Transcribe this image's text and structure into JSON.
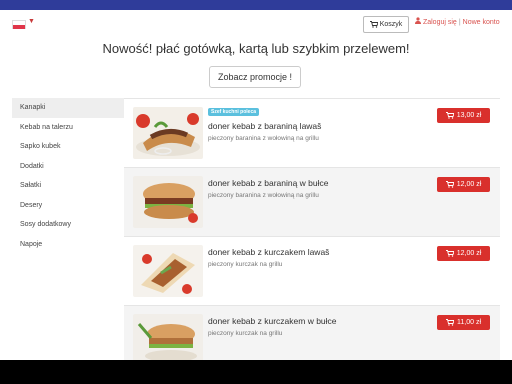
{
  "header": {
    "cart_label": "Koszyk",
    "login_label": "Zaloguj się",
    "separator": "|",
    "register_label": "Nowe konto",
    "icons": {
      "cart": "cart-icon",
      "user": "user-icon",
      "flag": "poland-flag-icon"
    }
  },
  "banner": {
    "headline": "Nowość! płać gotówką, kartą lub szybkim przelewem!",
    "promo_button": "Zobacz promocje !"
  },
  "sidebar": {
    "items": [
      {
        "label": "Kanapki",
        "active": true
      },
      {
        "label": "Kebab na talerzu",
        "active": false
      },
      {
        "label": "Sapko kubek",
        "active": false
      },
      {
        "label": "Dodatki",
        "active": false
      },
      {
        "label": "Sałatki",
        "active": false
      },
      {
        "label": "Desery",
        "active": false
      },
      {
        "label": "Sosy dodatkowy",
        "active": false
      },
      {
        "label": "Napoje",
        "active": false
      }
    ]
  },
  "products": [
    {
      "name": "doner kebab z baraniną lawaš",
      "description": "pieczony baranina z wołowiną na grillu",
      "price": "13,00 zł",
      "badge": "Szef kuchni poleca"
    },
    {
      "name": "doner kebab z baraniną w bułce",
      "description": "pieczony baranina z wołowiną na grillu",
      "price": "12,00 zł"
    },
    {
      "name": "doner kebab z kurczakem lawaš",
      "description": "pieczony kurczak na grillu",
      "price": "12,00 zł"
    },
    {
      "name": "doner kebab z kurczakem w bułce",
      "description": "pieczony kurczak na grillu",
      "price": "11,00 zł"
    }
  ],
  "colors": {
    "brand": "#2f3c9a",
    "accent": "#d9302c",
    "badge": "#5bc0de"
  }
}
